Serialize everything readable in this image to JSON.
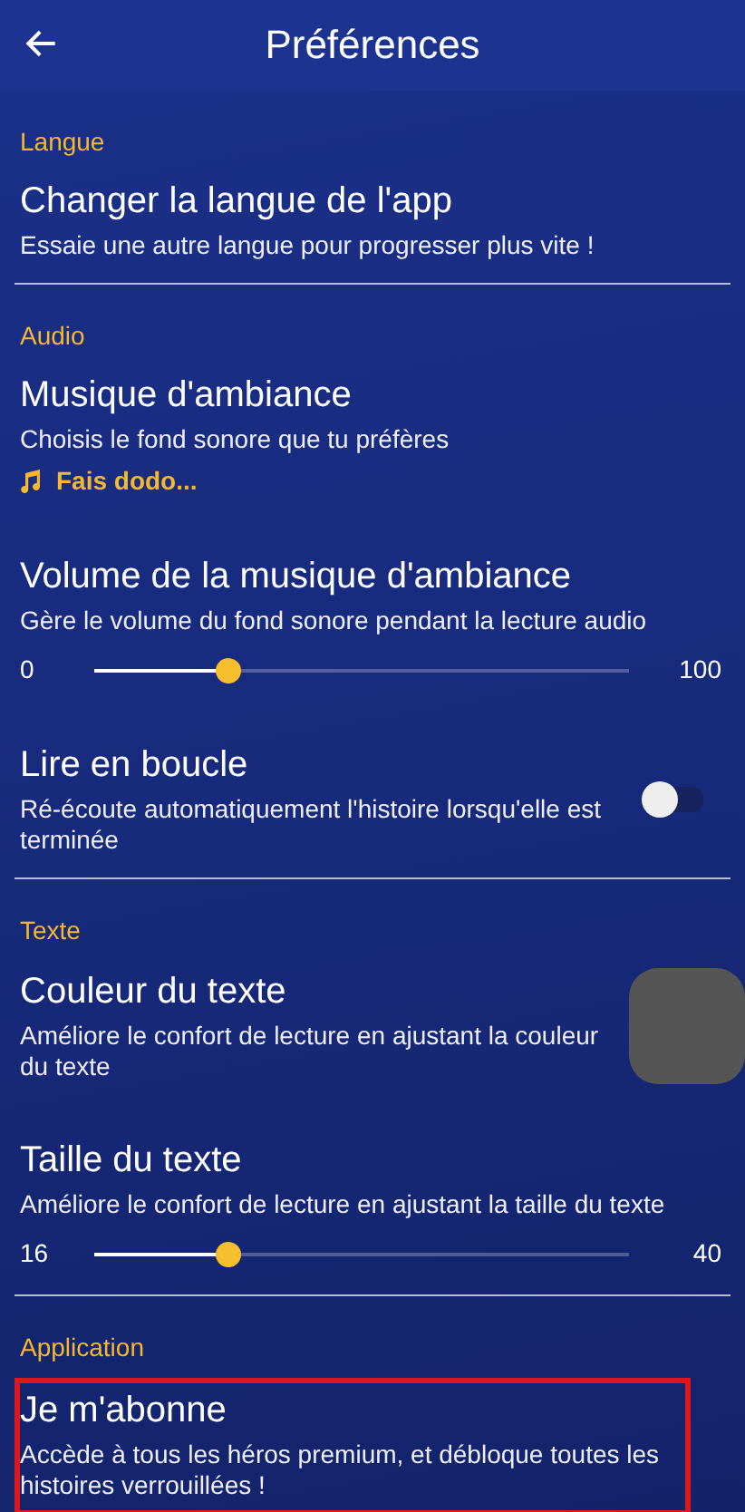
{
  "header": {
    "title": "Préférences"
  },
  "sections": [
    {
      "label": "Langue",
      "items": [
        {
          "kind": "link",
          "title": "Changer la langue de l'app",
          "description": "Essaie une autre langue pour progresser plus vite !",
          "highlighted": false
        }
      ]
    },
    {
      "label": "Audio",
      "items": [
        {
          "kind": "music",
          "title": "Musique d'ambiance",
          "description": "Choisis le fond sonore que tu préfères",
          "current": "Fais dodo...",
          "highlighted": false
        },
        {
          "kind": "slider",
          "title": "Volume de la musique d'ambiance",
          "description": "Gère le volume du fond sonore pendant la lecture audio",
          "min": "0",
          "max": "100",
          "level": 0.25,
          "highlighted": false
        },
        {
          "kind": "toggle",
          "title": "Lire en boucle",
          "description": "Ré-écoute automatiquement l'histoire lorsqu'elle est terminée",
          "on": false,
          "highlighted": false
        }
      ]
    },
    {
      "label": "Texte",
      "items": [
        {
          "kind": "color",
          "title": "Couleur du texte",
          "description": "Améliore le confort de lecture en ajustant la couleur du texte",
          "color": "#555555",
          "highlighted": false
        },
        {
          "kind": "slider",
          "title": "Taille du texte",
          "description": "Améliore le confort de lecture en ajustant la taille du texte",
          "min": "16",
          "max": "40",
          "level": 0.25,
          "highlighted": false
        }
      ]
    },
    {
      "label": "Application",
      "items": [
        {
          "kind": "link",
          "title": "Je m'abonne",
          "description": "Accède à tous les héros premium, et débloque toutes les histoires verrouillées !",
          "highlighted": true
        }
      ]
    }
  ]
}
